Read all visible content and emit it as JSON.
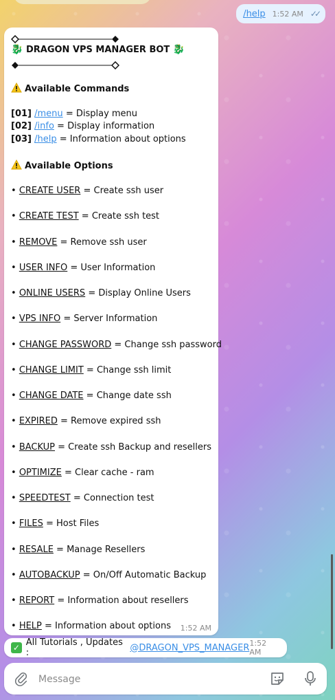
{
  "sent": {
    "command": "/help",
    "time": "1:52 AM"
  },
  "header": {
    "title": "DRAGON VPS MANAGER BOT",
    "dragon_glyph": "🐉"
  },
  "commands_title": "Available Commands",
  "commands": [
    {
      "num": "01",
      "cmd": "/menu",
      "desc": "= Display menu"
    },
    {
      "num": "02",
      "cmd": "/info",
      "desc": "= Display information"
    },
    {
      "num": "03",
      "cmd": "/help",
      "desc": "= Information about options"
    }
  ],
  "options_title": "Available Options",
  "options": [
    {
      "name": "CREATE USER",
      "desc": "= Create ssh user"
    },
    {
      "name": "CREATE TEST",
      "desc": "= Create ssh test"
    },
    {
      "name": "REMOVE",
      "desc": "= Remove ssh user"
    },
    {
      "name": "USER INFO",
      "desc": "= User Information"
    },
    {
      "name": "ONLINE USERS",
      "desc": "= Display Online Users"
    },
    {
      "name": "VPS INFO",
      "desc": "= Server Information"
    },
    {
      "name": "CHANGE PASSWORD",
      "desc": "= Change ssh password"
    },
    {
      "name": "CHANGE LIMIT",
      "desc": "= Change ssh limit"
    },
    {
      "name": "CHANGE DATE",
      "desc": "= Change date ssh"
    },
    {
      "name": "EXPIRED",
      "desc": "= Remove expired ssh"
    },
    {
      "name": "BACKUP",
      "desc": "= Create ssh Backup and resellers"
    },
    {
      "name": "OPTIMIZE",
      "desc": "= Clear cache - ram"
    },
    {
      "name": "SPEEDTEST",
      "desc": "= Connection test"
    },
    {
      "name": "FILES",
      "desc": "= Host Files"
    },
    {
      "name": "RESALE",
      "desc": "= Manage Resellers"
    },
    {
      "name": "AUTOBACKUP",
      "desc": "= On/Off Automatic Backup"
    },
    {
      "name": "REPORT",
      "desc": "= Information about resellers"
    },
    {
      "name": "HELP",
      "desc": "= Information about options"
    }
  ],
  "message_time": "1:52 AM",
  "tutorials": {
    "text": "All Tutorials , Updates :",
    "link": "@DRAGON_VPS_MANAGER",
    "time": "1:52 AM"
  },
  "composer": {
    "placeholder": "Message"
  },
  "colors": {
    "link": "#3a8ee6",
    "accent_check": "#3fb64a",
    "warning": "#f5c518"
  }
}
